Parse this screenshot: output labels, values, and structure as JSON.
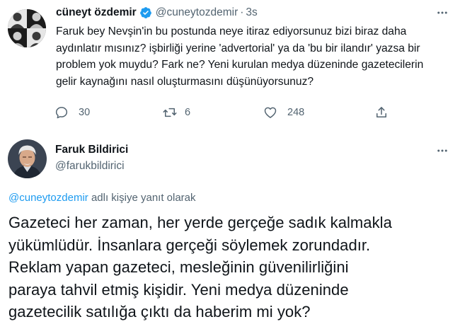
{
  "parent_tweet": {
    "author_name": "cüneyt özdemir",
    "handle": "@cuneytozdemir",
    "separator": "·",
    "time": "3s",
    "text": "Faruk bey Nevşin'in bu postunda neye itiraz ediyorsunuz bizi biraz daha\naydınlatır mısınız? işbirliği yerine 'advertorial' ya da 'bu bir ilandır' yazsa bir\nproblem yok muydu? Fark ne? Yeni kurulan medya düzeninde gazetecilerin\ngelir kaynağını nasıl oluşturmasını düşünüyorsunuz?",
    "reply_count": "30",
    "retweet_count": "6",
    "like_count": "248",
    "icons": {
      "verified": "verified-badge-icon",
      "more": "more-options-icon",
      "reply": "reply-icon",
      "retweet": "retweet-icon",
      "like": "heart-icon",
      "share": "share-icon"
    }
  },
  "reply_tweet": {
    "author_name": "Faruk Bildirici",
    "handle": "@farukbildirici",
    "replying_to_mention": "@cuneytozdemir",
    "replying_to_suffix": " adlı kişiye yanıt olarak",
    "text": "Gazeteci her zaman, her yerde gerçeğe sadık kalmakla\nyükümlüdür. İnsanlara gerçeği söylemek zorundadır.\nReklam yapan gazeteci, mesleğinin güvenilirliğini\nparaya tahvil etmiş kişidir. Yeni medya düzeninde\ngazetecilik satılığa çıktı da haberim mi yok?"
  },
  "colors": {
    "text_primary": "#0f1419",
    "text_secondary": "#536471",
    "accent_blue": "#1d9bf0"
  }
}
